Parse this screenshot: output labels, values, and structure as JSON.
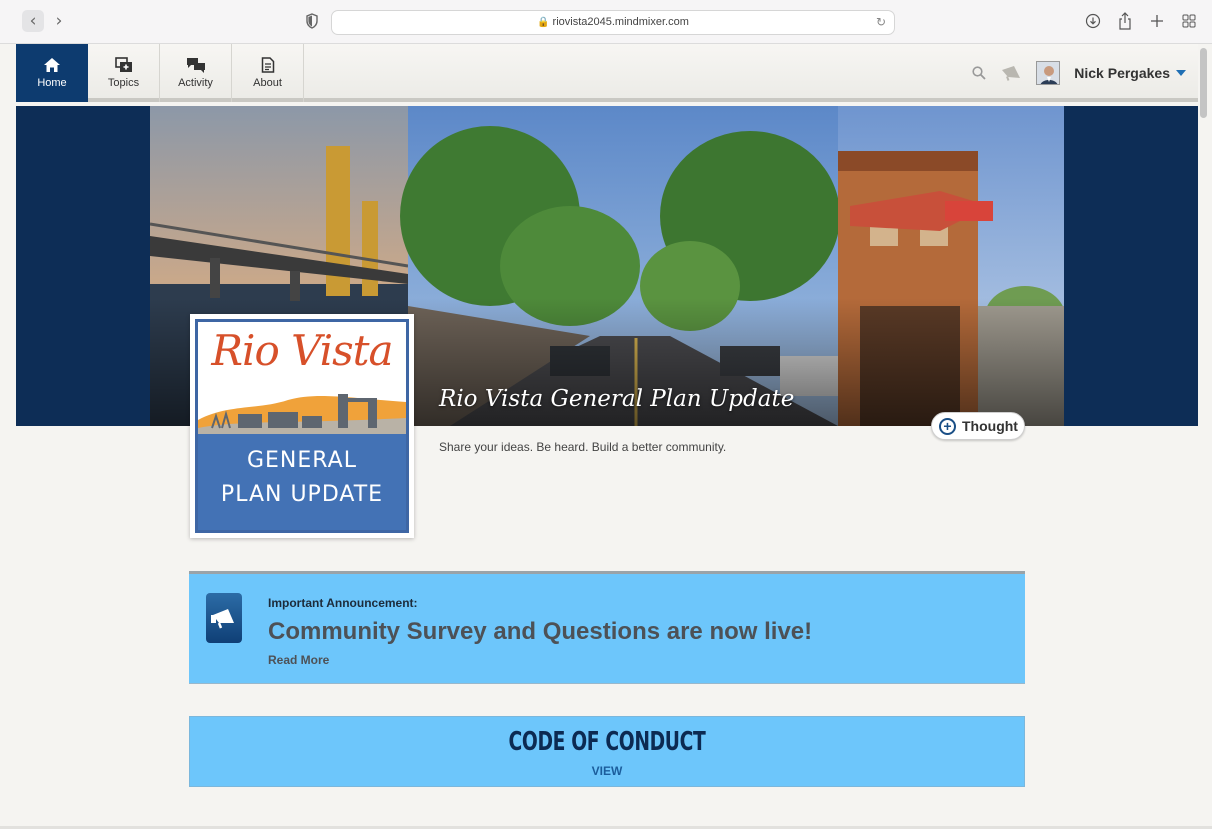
{
  "browser": {
    "url": "riovista2045.mindmixer.com",
    "back_glyph": "‹",
    "forward_glyph": "›",
    "reload_glyph": "↻",
    "lock_glyph": "🔒"
  },
  "toolbar": {
    "items": [
      {
        "label": "Home",
        "icon": "home-icon",
        "active": true
      },
      {
        "label": "Topics",
        "icon": "topics-icon",
        "active": false
      },
      {
        "label": "Activity",
        "icon": "activity-icon",
        "active": false
      },
      {
        "label": "About",
        "icon": "about-icon",
        "active": false
      }
    ],
    "user_name": "Nick Pergakes"
  },
  "hero": {
    "title": "Rio Vista General Plan Update",
    "tagline": "Share your ideas. Be heard. Build a better community.",
    "thought_button": "Thought"
  },
  "logo": {
    "script_text": "Rio Vista",
    "line1": "GENERAL",
    "line2": "PLAN UPDATE"
  },
  "announcement": {
    "kicker": "Important Announcement:",
    "headline": "Community Survey and Questions are now live!",
    "link": "Read More"
  },
  "code_of_conduct": {
    "title": "CODE OF CONDUCT",
    "link": "VIEW"
  },
  "colors": {
    "nav_active": "#0d3b6f",
    "hero_frame": "#0d2d56",
    "panel": "#6dc6fb",
    "logo_orange": "#d7502a",
    "logo_blue": "#4372b5"
  }
}
